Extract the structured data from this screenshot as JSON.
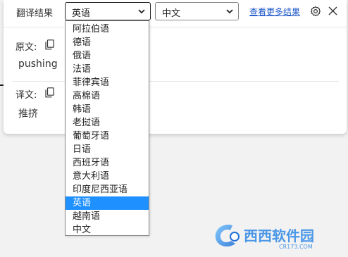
{
  "header": {
    "title": "翻译结果",
    "source_language": "英语",
    "target_language": "中文",
    "more_results_link": "查看更多结果"
  },
  "original": {
    "label": "原文:",
    "text": "pushing"
  },
  "translation": {
    "label": "译文:",
    "text": "推挤"
  },
  "dropdown": {
    "options": [
      "阿拉伯语",
      "德语",
      "俄语",
      "法语",
      "菲律宾语",
      "高棉语",
      "韩语",
      "老挝语",
      "葡萄牙语",
      "日语",
      "西班牙语",
      "意大利语",
      "印度尼西亚语",
      "英语",
      "越南语",
      "中文"
    ],
    "selected": "英语"
  },
  "watermark": {
    "brand": "西西软件园",
    "url": "CR173.COM"
  },
  "colors": {
    "selected_option": "#1e90ff",
    "link": "#1a56c8"
  },
  "icons": [
    "chevron-down-icon",
    "gear-icon",
    "close-icon",
    "copy-icon"
  ]
}
